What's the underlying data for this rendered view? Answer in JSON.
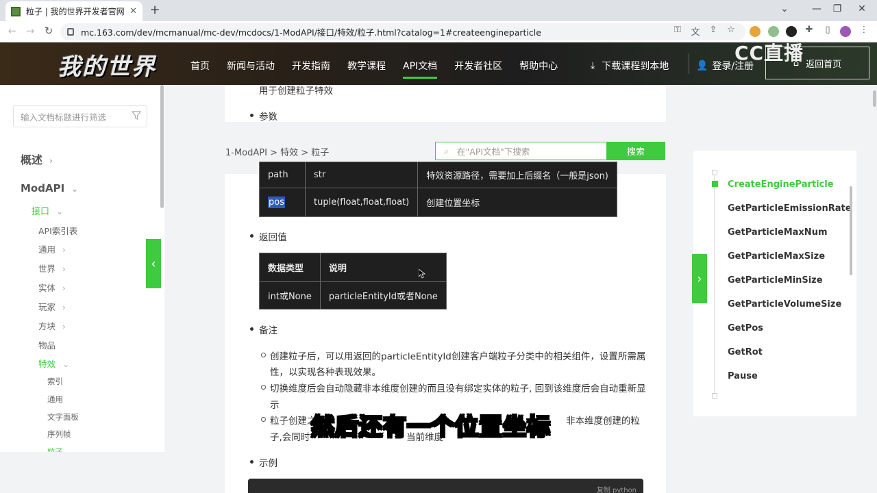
{
  "browser": {
    "tab_title": "粒子 | 我的世界开发者官网",
    "tab_close": "✕",
    "new_tab": "+",
    "url": "mc.163.com/dev/mcmanual/mc-dev/mcdocs/1-ModAPI/接口/特效/粒子.html?catalog=1#createengineparticle",
    "back": "←",
    "forward": "→",
    "reload": "↻",
    "minimize": "⌄",
    "win_min": "—",
    "win_max": "❐",
    "win_close": "✕"
  },
  "header": {
    "logo": "我的世界",
    "nav": [
      "首页",
      "新闻与活动",
      "开发指南",
      "教学课程",
      "API文档",
      "开发者社区",
      "帮助中心"
    ],
    "download": "下载课程到本地",
    "login": "登录/注册",
    "back_home": "返回首页",
    "watermark": "CC直播",
    "accent": "#3fca3f"
  },
  "sidebar": {
    "filter_placeholder": "输入文档标题进行筛选",
    "items": [
      {
        "label": "概述"
      },
      {
        "label": "ModAPI"
      },
      {
        "label": "接口"
      },
      {
        "label": "API索引表"
      },
      {
        "label": "通用"
      },
      {
        "label": "世界"
      },
      {
        "label": "实体"
      },
      {
        "label": "玩家"
      },
      {
        "label": "方块"
      },
      {
        "label": "物品"
      },
      {
        "label": "特效"
      },
      {
        "label": "索引"
      },
      {
        "label": "通用"
      },
      {
        "label": "文字面板"
      },
      {
        "label": "序列帧"
      },
      {
        "label": "粒子"
      }
    ]
  },
  "content": {
    "breadcrumb": "1-ModAPI > 特效 > 粒子",
    "search_placeholder": "在\"API文档\"下搜索",
    "search_button": "搜索",
    "desc": "用于创建粒子特效",
    "params_heading": "参数",
    "params_rows": [
      {
        "name": "path",
        "type": "str",
        "desc": "特效资源路径，需要加上后缀名（一般是json)"
      },
      {
        "name": "pos",
        "type": "tuple(float,float,float)",
        "desc": "创建位置坐标"
      }
    ],
    "return_heading": "返回值",
    "return_headers": [
      "数据类型",
      "说明"
    ],
    "return_row": {
      "type": "int或None",
      "desc": "particleEntityId或者None"
    },
    "notes_heading": "备注",
    "notes": [
      "创建粒子后，可以用返回的particleEntityId创建客户端粒子分类中的相关组件，设置所需属",
      "性，以实现各种表现效果。",
      "切换维度后会自动隐藏非本维度创建的而且没有绑定实体的粒子, 回到该维度后会自动重新显",
      "示",
      "粒子创建之",
      "非本维度创建的粒",
      "子,会同时",
      "当前维度"
    ],
    "example_heading": "示例",
    "code_lang": "复制 python",
    "subtitle": "然后还有一个位置坐标"
  },
  "toc": {
    "items": [
      {
        "label": "CreateEngineParticle",
        "active": true
      },
      {
        "label": "GetParticleEmissionRate"
      },
      {
        "label": "GetParticleMaxNum"
      },
      {
        "label": "GetParticleMaxSize"
      },
      {
        "label": "GetParticleMinSize"
      },
      {
        "label": "GetParticleVolumeSize"
      },
      {
        "label": "GetPos"
      },
      {
        "label": "GetRot"
      },
      {
        "label": "Pause"
      }
    ]
  }
}
